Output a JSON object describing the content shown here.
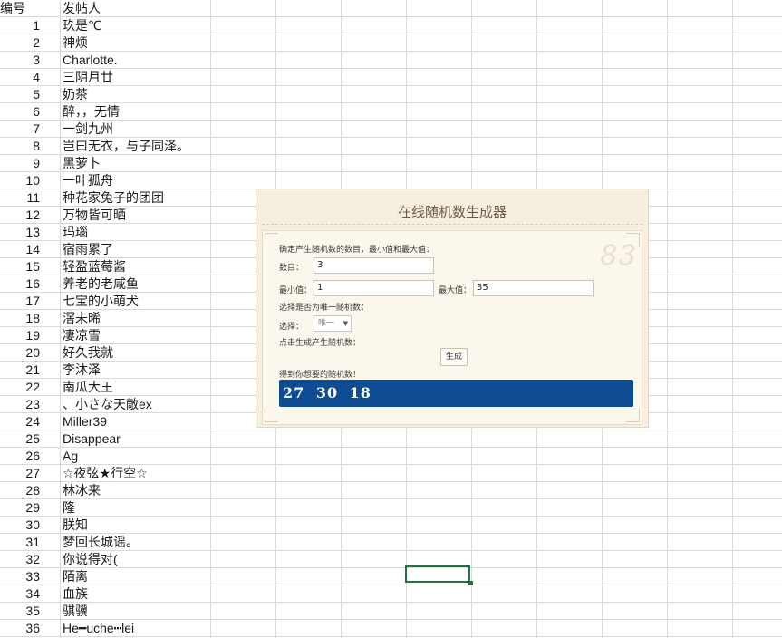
{
  "sheet": {
    "header": {
      "col_a": "编号",
      "col_b": "发帖人"
    },
    "rows": [
      {
        "num": "1",
        "name": "玖是℃"
      },
      {
        "num": "2",
        "name": "神烦"
      },
      {
        "num": "3",
        "name": "Charlotte."
      },
      {
        "num": "4",
        "name": "三阴月廿"
      },
      {
        "num": "5",
        "name": "奶茶"
      },
      {
        "num": "6",
        "name": "醉，，无情"
      },
      {
        "num": "7",
        "name": "一剑九州"
      },
      {
        "num": "8",
        "name": "岂曰无衣，与子同泽。"
      },
      {
        "num": "9",
        "name": "黑萝卜"
      },
      {
        "num": "10",
        "name": "一叶孤舟"
      },
      {
        "num": "11",
        "name": "种花家兔子的团团"
      },
      {
        "num": "12",
        "name": "万物皆可晒"
      },
      {
        "num": "13",
        "name": "玛瑙"
      },
      {
        "num": "14",
        "name": "宿雨累了"
      },
      {
        "num": "15",
        "name": "轻盈蓝莓酱"
      },
      {
        "num": "16",
        "name": "养老的老咸鱼"
      },
      {
        "num": "17",
        "name": "七宝的小萌犬"
      },
      {
        "num": "18",
        "name": "滘未晞"
      },
      {
        "num": "19",
        "name": "凄凉雪"
      },
      {
        "num": "20",
        "name": "好久我就"
      },
      {
        "num": "21",
        "name": "李沐泽"
      },
      {
        "num": "22",
        "name": "南瓜大王"
      },
      {
        "num": "23",
        "name": "、小さな天敵ex_"
      },
      {
        "num": "24",
        "name": "Miller39"
      },
      {
        "num": "25",
        "name": "Disappear"
      },
      {
        "num": "26",
        "name": "Ag"
      },
      {
        "num": "27",
        "name": "☆夜弦★行空☆"
      },
      {
        "num": "28",
        "name": "林冰来"
      },
      {
        "num": "29",
        "name": "隆"
      },
      {
        "num": "30",
        "name": "朕知"
      },
      {
        "num": "31",
        "name": "梦回长城谣。"
      },
      {
        "num": "32",
        "name": "你说得对("
      },
      {
        "num": "33",
        "name": "陌离"
      },
      {
        "num": "34",
        "name": "血族"
      },
      {
        "num": "35",
        "name": "骐骥"
      },
      {
        "num": "36",
        "name": "He━uche┅lei"
      }
    ],
    "selection_color": "#217346",
    "grid_color": "#d9d9d9"
  },
  "generator": {
    "title": "在线随机数生成器",
    "instruction": "确定产生随机数的数目，最小值和最大值：",
    "count_label": "数目：",
    "count_value": "3",
    "min_label": "最小值：",
    "min_value": "1",
    "max_label": "最大值：",
    "max_value": "35",
    "unique_instruction": "选择是否为唯一随机数：",
    "select_label": "选择：",
    "select_value": "唯一",
    "click_instruction": "点击生成产生随机数：",
    "generate_label": "生成",
    "result_label": "得到你想要的随机数！",
    "result_value": "27 30 18",
    "result_color": "#0e4d93"
  }
}
